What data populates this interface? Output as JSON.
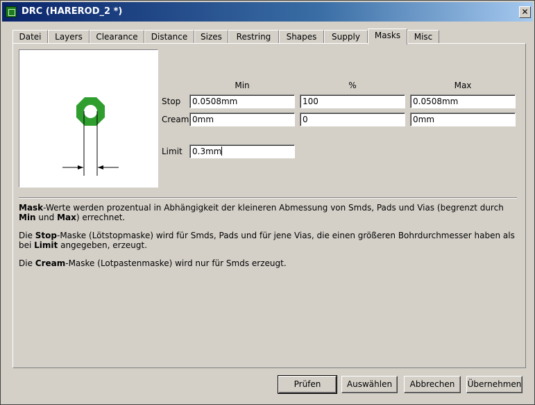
{
  "window": {
    "title": "DRC (HAREROD_2 *)"
  },
  "tabs": [
    {
      "label": "Datei"
    },
    {
      "label": "Layers"
    },
    {
      "label": "Clearance"
    },
    {
      "label": "Distance"
    },
    {
      "label": "Sizes"
    },
    {
      "label": "Restring"
    },
    {
      "label": "Shapes"
    },
    {
      "label": "Supply"
    },
    {
      "label": "Masks",
      "active": true
    },
    {
      "label": "Misc"
    }
  ],
  "masks": {
    "headers": {
      "min": "Min",
      "percent": "%",
      "max": "Max"
    },
    "stop": {
      "label": "Stop",
      "min": "0.0508mm",
      "percent": "100",
      "max": "0.0508mm"
    },
    "cream": {
      "label": "Cream",
      "min": "0mm",
      "percent": "0",
      "max": "0mm"
    },
    "limit": {
      "label": "Limit",
      "value": "0.3mm"
    },
    "description": {
      "p1": [
        {
          "text": "Mask",
          "bold": true
        },
        {
          "text": "-Werte werden prozentual in Abhängigkeit der kleineren Abmessung von Smds, Pads und Vias (begrenzt durch "
        },
        {
          "text": "Min",
          "bold": true
        },
        {
          "text": " und "
        },
        {
          "text": "Max",
          "bold": true
        },
        {
          "text": ") errechnet."
        }
      ],
      "p2": [
        {
          "text": "Die "
        },
        {
          "text": "Stop",
          "bold": true
        },
        {
          "text": "-Maske (Lötstopmaske) wird für Smds, Pads und für jene Vias, die einen größeren Bohrdurchmesser haben als bei "
        },
        {
          "text": "Limit",
          "bold": true
        },
        {
          "text": " angegeben, erzeugt."
        }
      ],
      "p3": [
        {
          "text": "Die "
        },
        {
          "text": "Cream",
          "bold": true
        },
        {
          "text": "-Maske (Lotpastenmaske) wird nur für Smds erzeugt."
        }
      ]
    }
  },
  "buttons": {
    "check": "Prüfen",
    "select": "Auswählen",
    "cancel": "Abbrechen",
    "apply": "Übernehmen"
  },
  "colors": {
    "pad": "#2f9e2f",
    "title_start": "#0a246a",
    "title_end": "#a6caf0"
  }
}
